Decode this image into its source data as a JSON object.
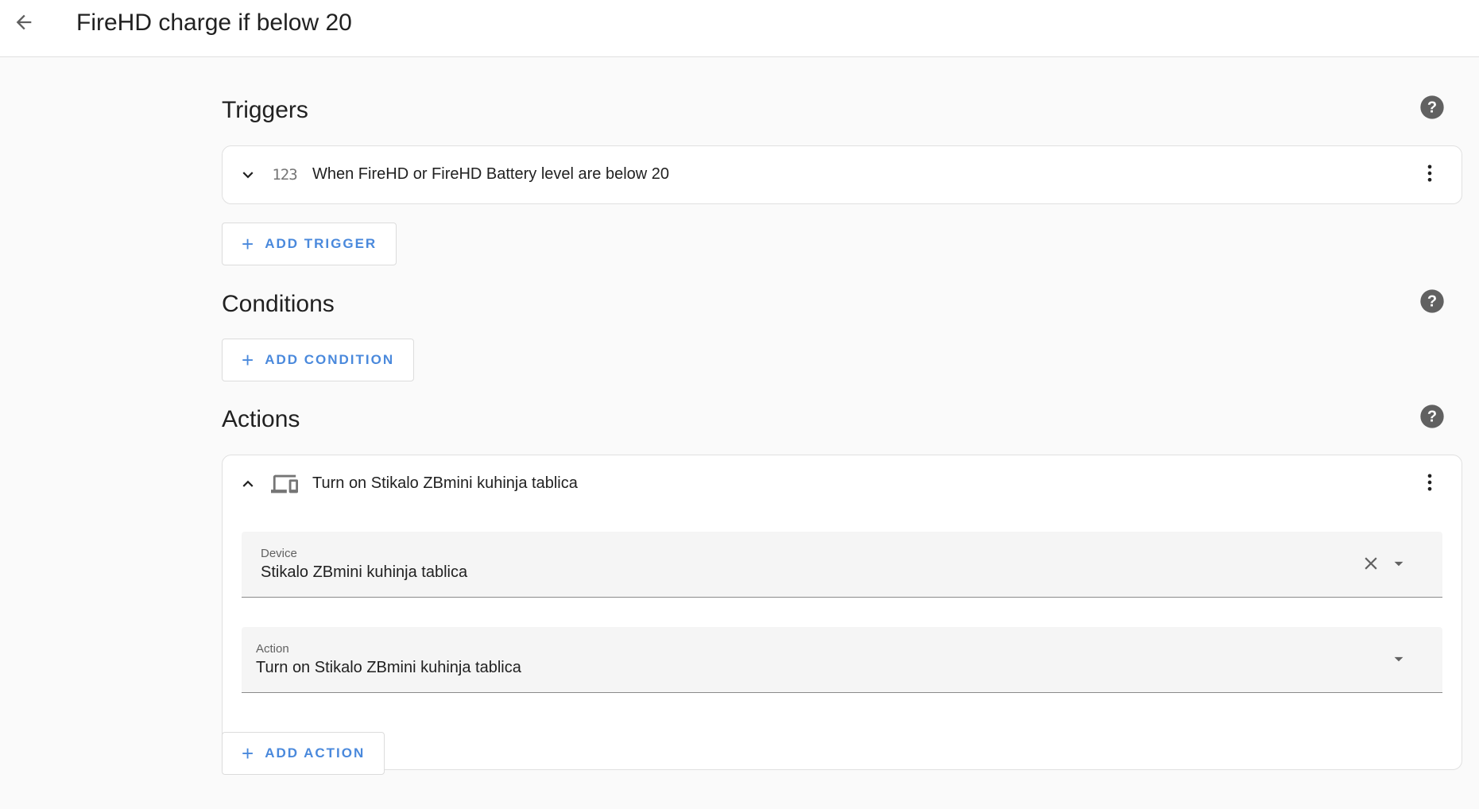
{
  "header": {
    "title": "FireHD charge if below 20",
    "back_icon": "arrow-left-icon"
  },
  "triggers": {
    "title": "Triggers",
    "items": [
      {
        "label": "When FireHD or FireHD Battery level are below 20",
        "icon_text": "123",
        "expanded": false
      }
    ],
    "add_label": "ADD TRIGGER"
  },
  "conditions": {
    "title": "Conditions",
    "add_label": "ADD CONDITION"
  },
  "actions": {
    "title": "Actions",
    "items": [
      {
        "label": "Turn on Stikalo ZBmini kuhinja tablica",
        "expanded": true,
        "device_field": {
          "label": "Device",
          "value": "Stikalo ZBmini kuhinja tablica"
        },
        "action_field": {
          "label": "Action",
          "value": "Turn on Stikalo ZBmini kuhinja tablica"
        }
      }
    ],
    "add_label": "ADD ACTION"
  },
  "colors": {
    "accent": "#4a89dc",
    "help_icon": "#616161"
  }
}
